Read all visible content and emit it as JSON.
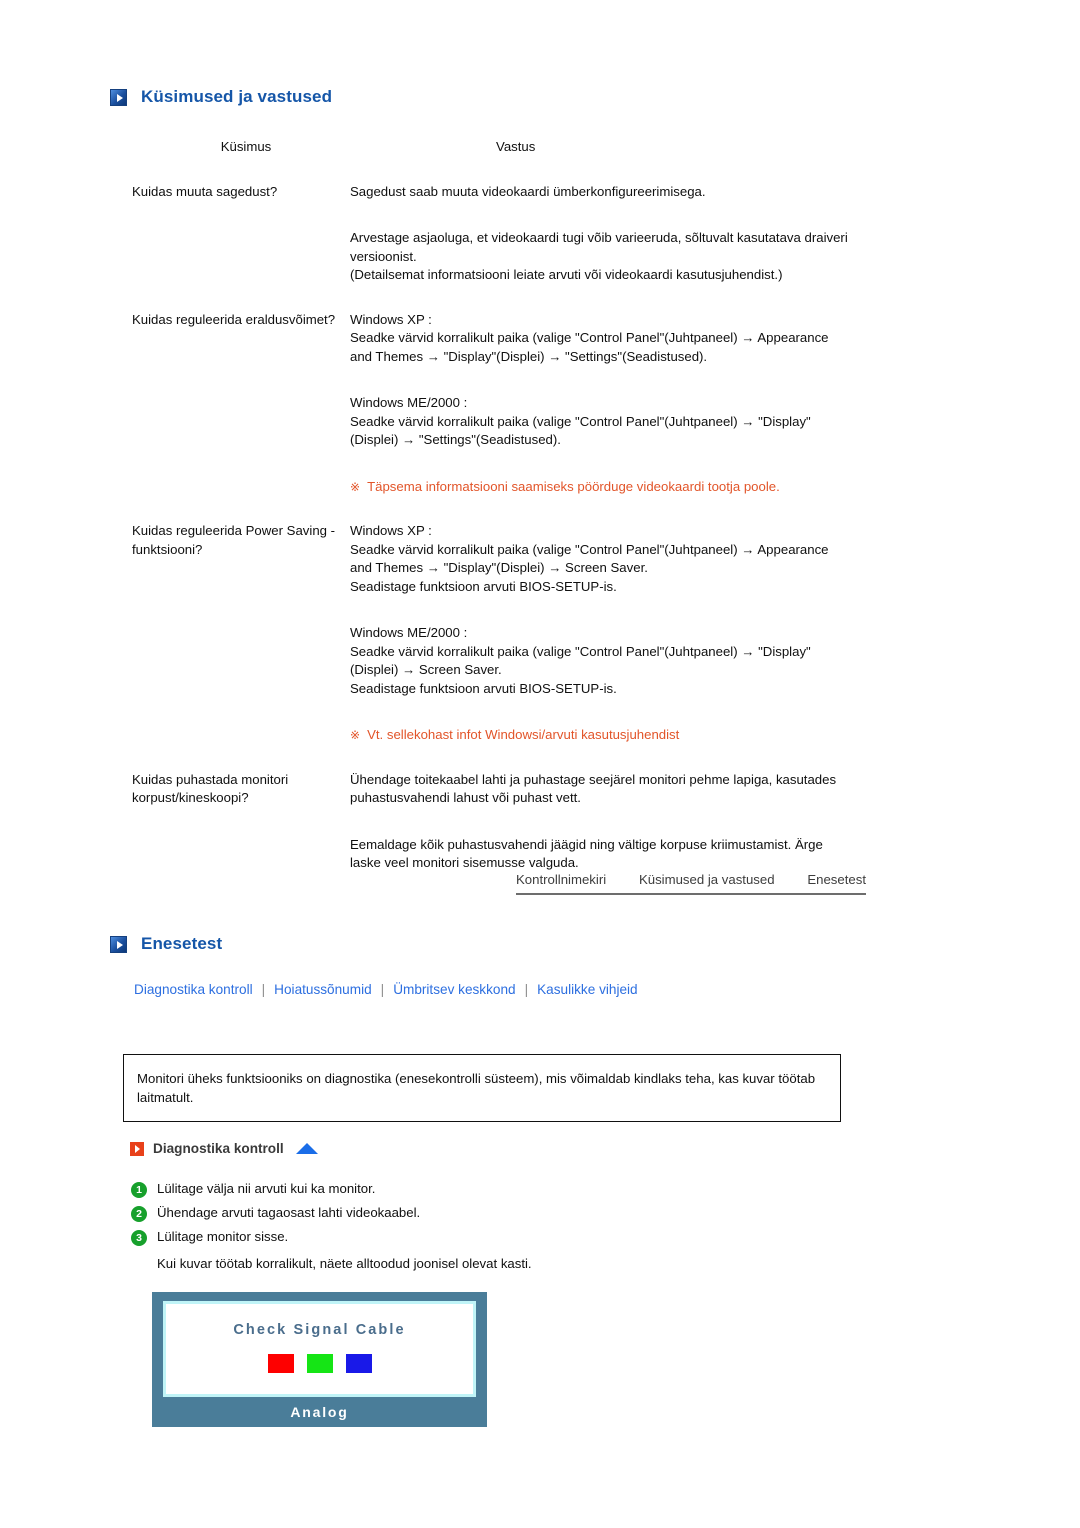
{
  "faq_section": {
    "title": "Küsimused ja vastused",
    "icon": "play-square-blue-icon",
    "table": {
      "headers": {
        "question": "Küsimus",
        "answer": "Vastus"
      },
      "rows": [
        {
          "question": "Kuidas muuta sagedust?",
          "answer_blocks": [
            "Sagedust saab muuta videokaardi ümberkonfigureerimisega.",
            "Arvestage asjaoluga, et videokaardi tugi võib varieeruda, sõltuvalt kasutatava draiveri versioonist.\n(Detailsemat informatsiooni leiate arvuti või videokaardi kasutusjuhendist.)"
          ],
          "note": null
        },
        {
          "question": "Kuidas reguleerida eraldusvõimet?",
          "answer_blocks": [
            "Windows XP :\nSeadke värvid korralikult paika (valige \"Control Panel\"(Juhtpaneel) → Appearance and Themes → \"Display\"(Displei) → \"Settings\"(Seadistused).",
            "Windows ME/2000 :\nSeadke värvid korralikult paika (valige \"Control Panel\"(Juhtpaneel) → \"Display\"(Displei) → \"Settings\"(Seadistused)."
          ],
          "note": {
            "mark": "※",
            "text": "Täpsema informatsiooni saamiseks pöörduge videokaardi tootja poole.",
            "color": "#e2552a"
          }
        },
        {
          "question": "Kuidas reguleerida Power Saving -funktsiooni?",
          "answer_blocks": [
            "Windows XP :\nSeadke värvid korralikult paika (valige \"Control Panel\"(Juhtpaneel) → Appearance and Themes → \"Display\"(Displei) → Screen Saver.\nSeadistage funktsioon arvuti BIOS-SETUP-is.",
            "Windows ME/2000 :\nSeadke värvid korralikult paika (valige \"Control Panel\"(Juhtpaneel) → \"Display\"(Displei) → Screen Saver.\nSeadistage funktsioon arvuti BIOS-SETUP-is."
          ],
          "note": {
            "mark": "※",
            "text": "Vt. sellekohast infot Windowsi/arvuti kasutusjuhendist",
            "color": "#e2552a"
          }
        },
        {
          "question": "Kuidas puhastada monitori korpust/kineskoopi?",
          "answer_blocks": [
            "Ühendage toitekaabel lahti ja puhastage seejärel monitori pehme lapiga, kasutades puhastusvahendi lahust või puhast vett.",
            "Eemaldage kõik puhastusvahendi jäägid ning vältige korpuse kriimustamist. Ärge laske veel monitori sisemusse valguda."
          ],
          "note": null
        }
      ]
    }
  },
  "tabbar": {
    "tabs": [
      {
        "label": "Kontrollnimekiri"
      },
      {
        "label": "Küsimused ja vastused"
      },
      {
        "label": "Enesetest"
      }
    ]
  },
  "selftest_section": {
    "title": "Enesetest",
    "icon": "play-square-blue-icon",
    "links": [
      {
        "label": "Diagnostika kontroll"
      },
      {
        "label": "Hoiatussõnumid"
      },
      {
        "label": "Ümbritsev keskkond"
      },
      {
        "label": "Kasulikke vihjeid"
      }
    ],
    "link_separator": "|",
    "link_color": "#2d6fe0",
    "infobox_text": "Monitori üheks funktsiooniks on diagnostika (enesekontrolli süsteem), mis võimaldab kindlaks teha, kas kuvar töötab laitmatult.",
    "subsection": {
      "title": "Diagnostika kontroll",
      "icon": "play-square-red-icon",
      "top_arrow_icon": "triangle-up-blue-icon",
      "steps": [
        {
          "num": "1",
          "text": "Lülitage välja nii arvuti kui ka monitor."
        },
        {
          "num": "2",
          "text": "Ühendage arvuti tagaosast lahti videokaabel."
        },
        {
          "num": "3",
          "text": "Lülitage monitor sisse."
        }
      ],
      "step_note": "Kui kuvar töötab korralikult, näete alltoodud joonisel olevat kasti."
    },
    "monitor_figure": {
      "message": "Check Signal Cable",
      "label": "Analog",
      "swatches": [
        {
          "name": "red-swatch",
          "color": "#fe0000"
        },
        {
          "name": "green-swatch",
          "color": "#15e515"
        },
        {
          "name": "blue-swatch",
          "color": "#1919e8"
        }
      ],
      "frame_color": "#4a7d99",
      "inner_border_color": "#c0f4f7"
    }
  }
}
